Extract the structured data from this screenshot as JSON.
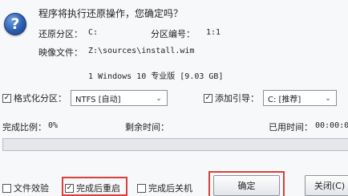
{
  "dialog": {
    "icon": "question-icon",
    "message": "程序将执行还原操作，您确定吗？",
    "restore_partition_label": "还原分区：",
    "restore_partition_value": "C:",
    "partition_number_label": "分区编号：",
    "partition_number_value": "1:1",
    "image_file_label": "映像文件：",
    "image_file_value": "Z:\\sources\\install.wim",
    "image_desc": "1 Windows 10 专业版 [9.03 GB]"
  },
  "options": {
    "format_label": "格式化分区：",
    "format_checked": true,
    "format_value": "NTFS [自动]",
    "boot_label": "添加引导：",
    "boot_checked": true,
    "boot_value": "C: [推荐]"
  },
  "status": {
    "completion_label": "完成比例：",
    "completion_value": "0%",
    "remaining_label": "剩余时间：",
    "remaining_value": "",
    "elapsed_label": "已用时间：",
    "elapsed_value": "00:00:0",
    "progress_fraction": 0
  },
  "footer": {
    "verify_label": "文件效验",
    "verify_checked": false,
    "restart_label": "完成后重启",
    "restart_checked": true,
    "shutdown_label": "完成后关机",
    "shutdown_checked": false,
    "ok_label": "确定",
    "close_label": "关闭(C)"
  },
  "colors": {
    "highlight": "#d9413a",
    "progress_fill": "#3a8ee6"
  }
}
